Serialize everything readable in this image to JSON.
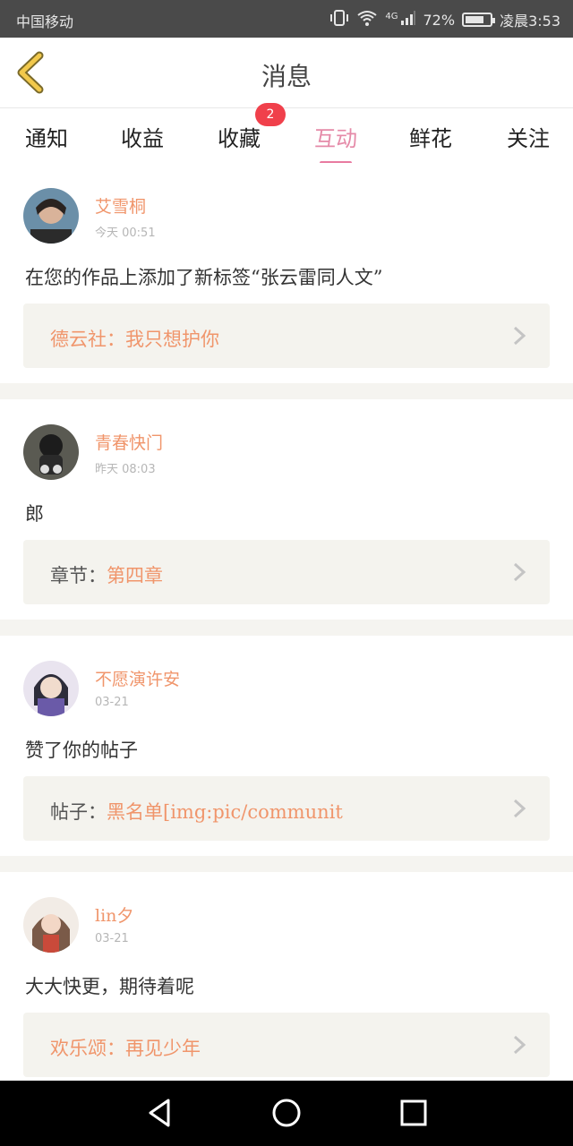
{
  "status_bar": {
    "carrier": "中国移动",
    "network": "4G",
    "battery": "72%",
    "battery_level": 0.72,
    "time": "凌晨3:53"
  },
  "header": {
    "title": "消息"
  },
  "tabs": [
    {
      "label": "通知",
      "active": false
    },
    {
      "label": "收益",
      "active": false
    },
    {
      "label": "收藏",
      "active": false,
      "badge": "2"
    },
    {
      "label": "互动",
      "active": true
    },
    {
      "label": "鲜花",
      "active": false
    },
    {
      "label": "关注",
      "active": false
    }
  ],
  "messages": [
    {
      "user": "艾雪桐",
      "time": "今天 00:51",
      "text": "在您的作品上添加了新标签“张云雷同人文”",
      "ref_prefix": "",
      "ref_text": "德云社：我只想护你"
    },
    {
      "user": "青春快门",
      "time": "昨天 08:03",
      "text": "郎",
      "ref_prefix": "章节：",
      "ref_text": "第四章"
    },
    {
      "user": "不愿演许安",
      "time": "03-21",
      "text": "赞了你的帖子",
      "ref_prefix": "帖子：",
      "ref_text": "黑名单[img:pic/communit"
    },
    {
      "user": "lin夕",
      "time": "03-21",
      "text": "大大快更，期待着呢",
      "ref_prefix": "",
      "ref_text": "欢乐颂：再见少年"
    }
  ],
  "colors": {
    "accent_pink": "#e87aa0",
    "name_orange": "#f0956b",
    "badge_red": "#f0404b",
    "back_arrow_yellow": "#f2c94c"
  }
}
